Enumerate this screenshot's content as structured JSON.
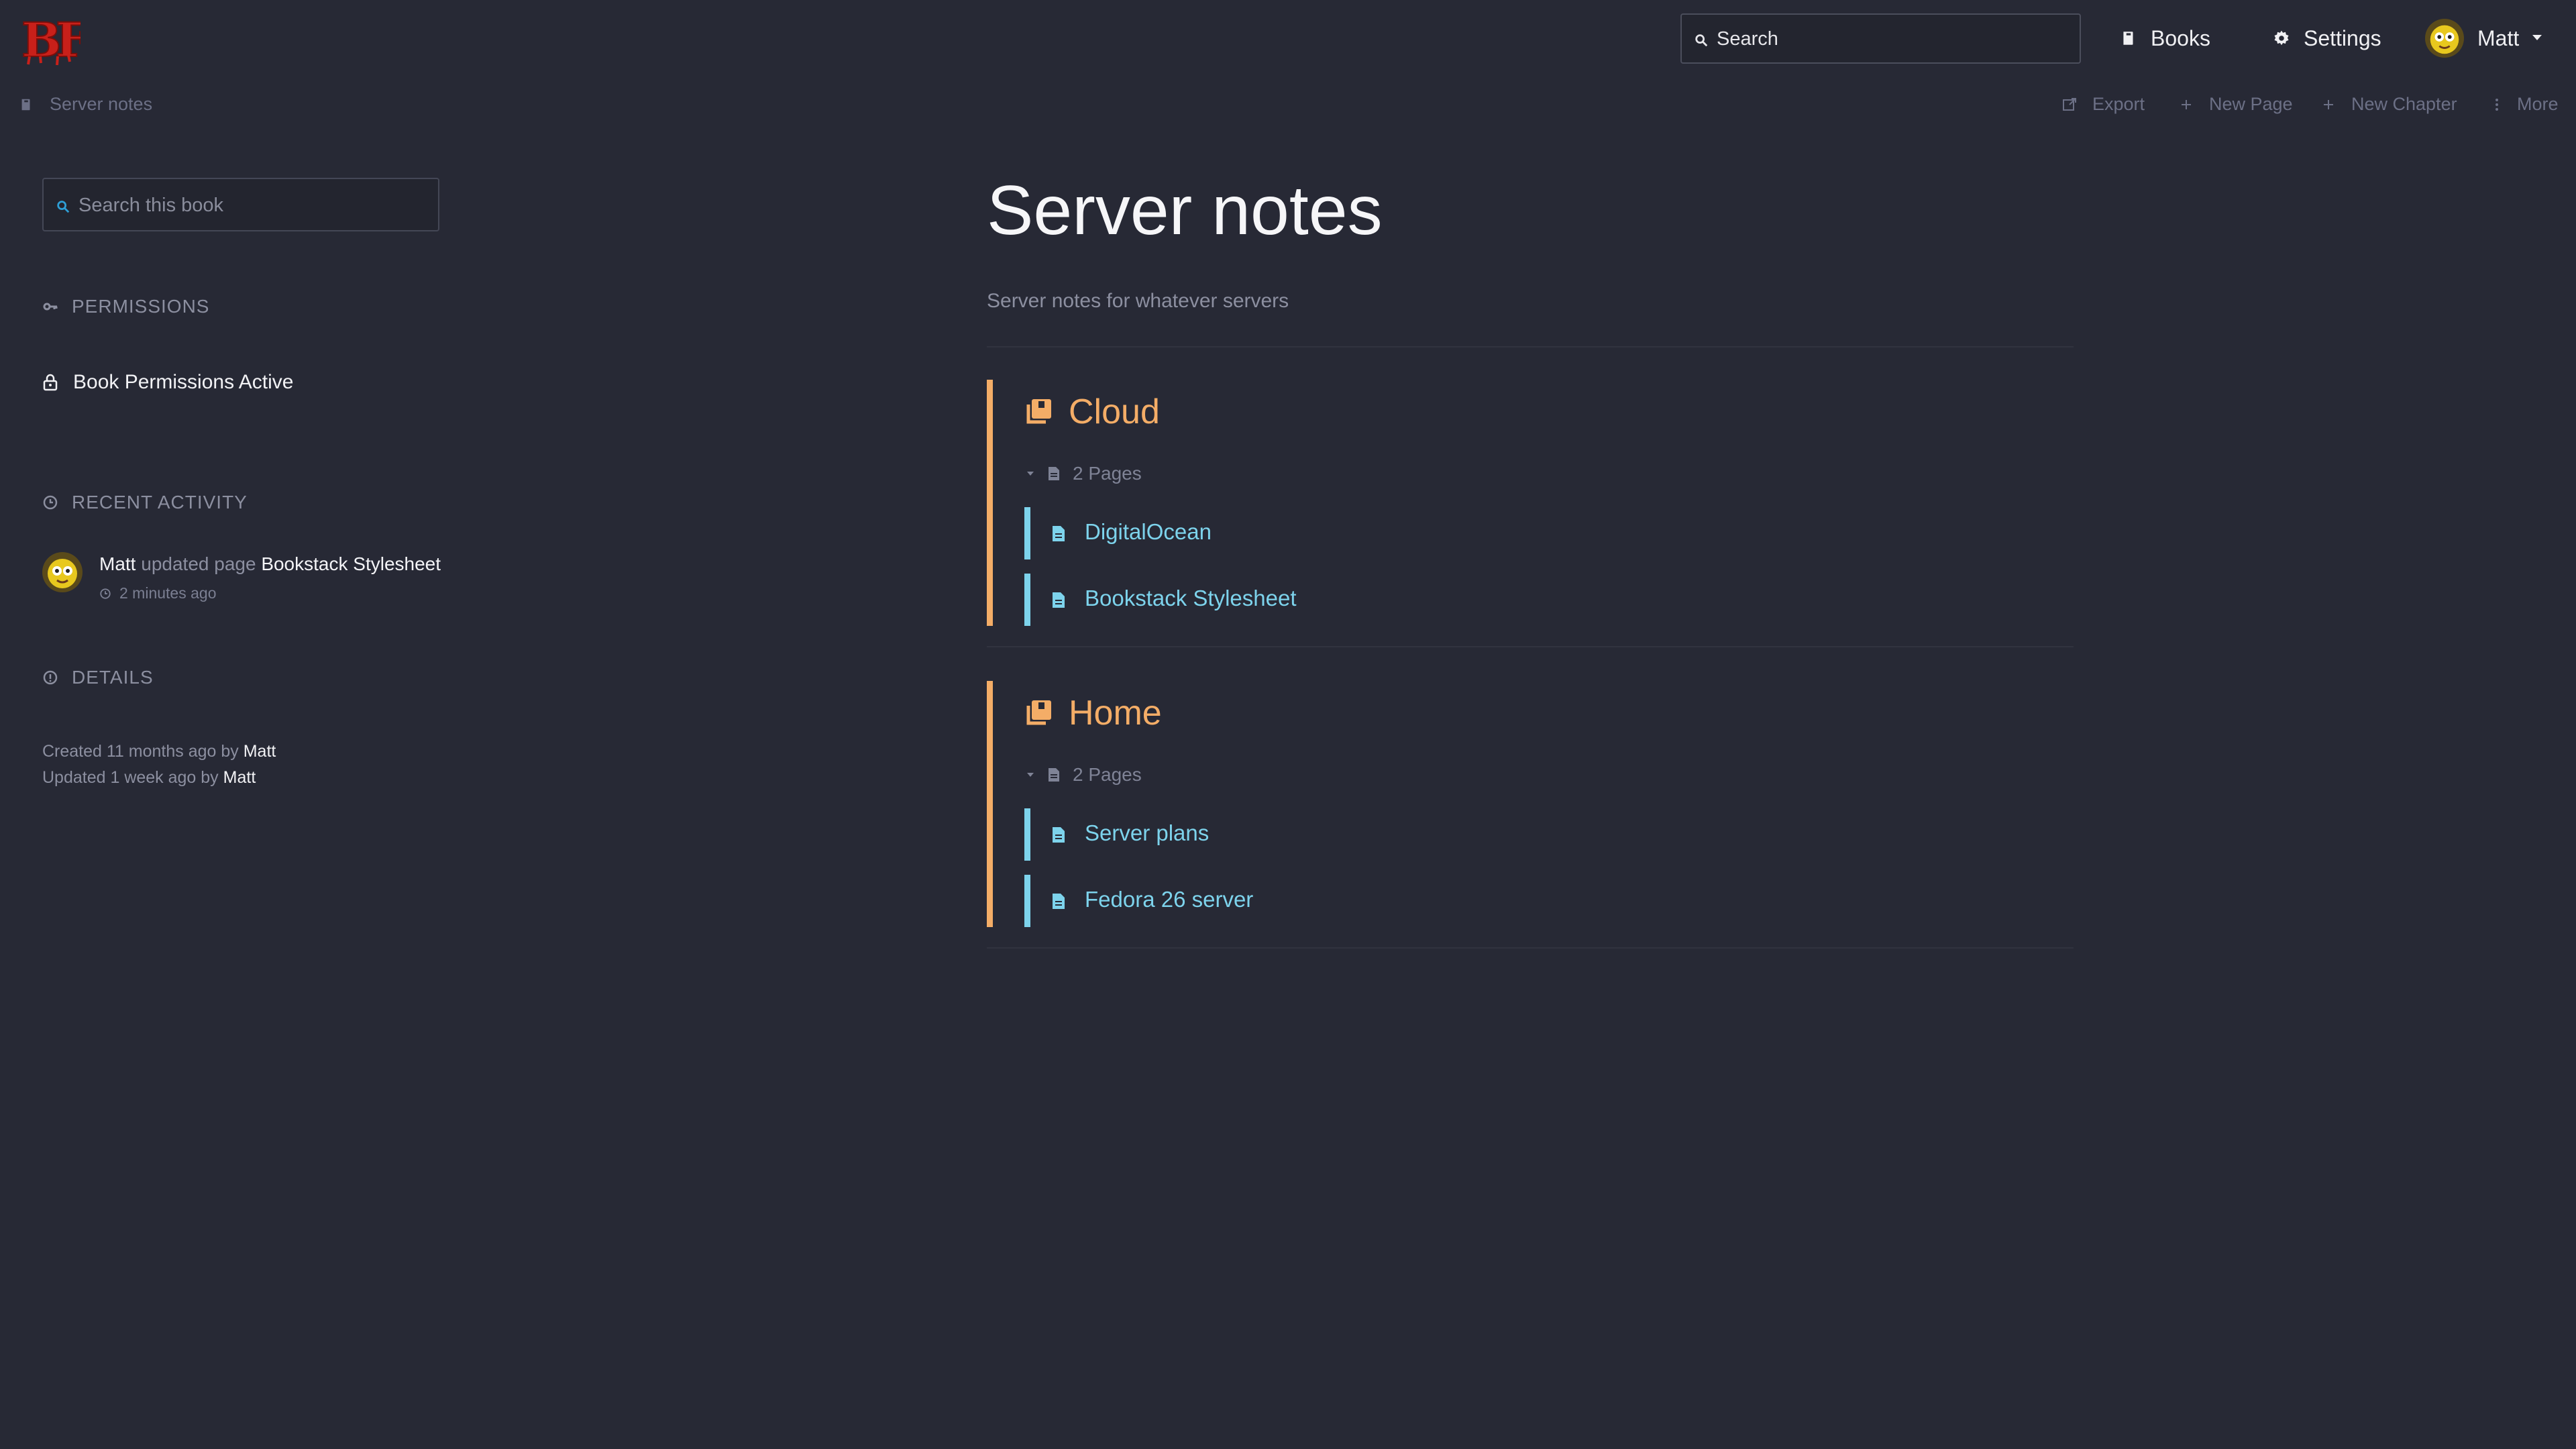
{
  "header": {
    "logo_text": "BF",
    "search_placeholder": "Search",
    "nav": {
      "books": "Books",
      "settings": "Settings",
      "user": "Matt"
    }
  },
  "toolbar": {
    "breadcrumb": "Server notes",
    "export": "Export",
    "new_page": "New Page",
    "new_chapter": "New Chapter",
    "more": "More"
  },
  "sidebar": {
    "book_search_placeholder": "Search this book",
    "permissions_title": "PERMISSIONS",
    "permissions_status": "Book Permissions Active",
    "recent_activity_title": "RECENT ACTIVITY",
    "activity": {
      "user": "Matt",
      "action": "updated page",
      "target": "Bookstack Stylesheet",
      "time": "2 minutes ago"
    },
    "details_title": "DETAILS",
    "details": {
      "created_prefix": "Created 11 months ago by",
      "created_by": "Matt",
      "updated_prefix": "Updated 1 week ago by",
      "updated_by": "Matt"
    }
  },
  "main": {
    "title": "Server notes",
    "description": "Server notes for whatever servers",
    "chapters": [
      {
        "name": "Cloud",
        "pages_count": "2 Pages",
        "pages": [
          "DigitalOcean",
          "Bookstack Stylesheet"
        ]
      },
      {
        "name": "Home",
        "pages_count": "2 Pages",
        "pages": [
          "Server plans",
          "Fedora 26 server"
        ]
      }
    ]
  },
  "colors": {
    "background": "#272935",
    "chapter_accent": "#f4ad67",
    "page_accent": "#7dd3ec",
    "muted": "#8c8fa0"
  }
}
